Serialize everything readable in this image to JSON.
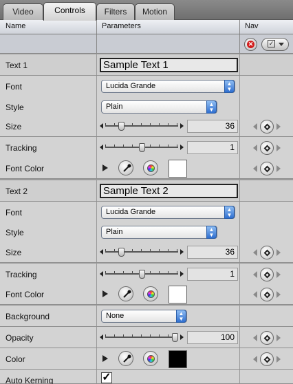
{
  "tabs": [
    {
      "label": "Video"
    },
    {
      "label": "Controls"
    },
    {
      "label": "Filters"
    },
    {
      "label": "Motion"
    }
  ],
  "active_tab": "Controls",
  "columns": {
    "name": "Name",
    "parameters": "Parameters",
    "nav": "Nav"
  },
  "rows": {
    "text1": {
      "label": "Text 1",
      "value": "Sample Text 1"
    },
    "font1": {
      "label": "Font",
      "value": "Lucida Grande"
    },
    "style1": {
      "label": "Style",
      "value": "Plain"
    },
    "size1": {
      "label": "Size",
      "value": "36",
      "slider_fraction": 0.2
    },
    "tracking1": {
      "label": "Tracking",
      "value": "1",
      "slider_fraction": 0.5
    },
    "fontcolor1": {
      "label": "Font Color",
      "swatch_color": "#ffffff"
    },
    "text2": {
      "label": "Text 2",
      "value": "Sample Text 2"
    },
    "font2": {
      "label": "Font",
      "value": "Lucida Grande"
    },
    "style2": {
      "label": "Style",
      "value": "Plain"
    },
    "size2": {
      "label": "Size",
      "value": "36",
      "slider_fraction": 0.2
    },
    "tracking2": {
      "label": "Tracking",
      "value": "1",
      "slider_fraction": 0.5
    },
    "fontcolor2": {
      "label": "Font Color",
      "swatch_color": "#ffffff"
    },
    "background": {
      "label": "Background",
      "value": "None"
    },
    "opacity": {
      "label": "Opacity",
      "value": "100",
      "slider_fraction": 1.0
    },
    "color": {
      "label": "Color",
      "swatch_color": "#000000"
    },
    "autokerning": {
      "label": "Auto Kerning",
      "checked": true,
      "check_glyph": "✓"
    }
  },
  "icons": {
    "reset": "reset-x-icon",
    "menu": "checkmark-menu-icon",
    "keyframe": "keyframe-diamond-icon",
    "eyedropper": "eyedropper-icon",
    "colorwheel": "color-wheel-icon"
  }
}
